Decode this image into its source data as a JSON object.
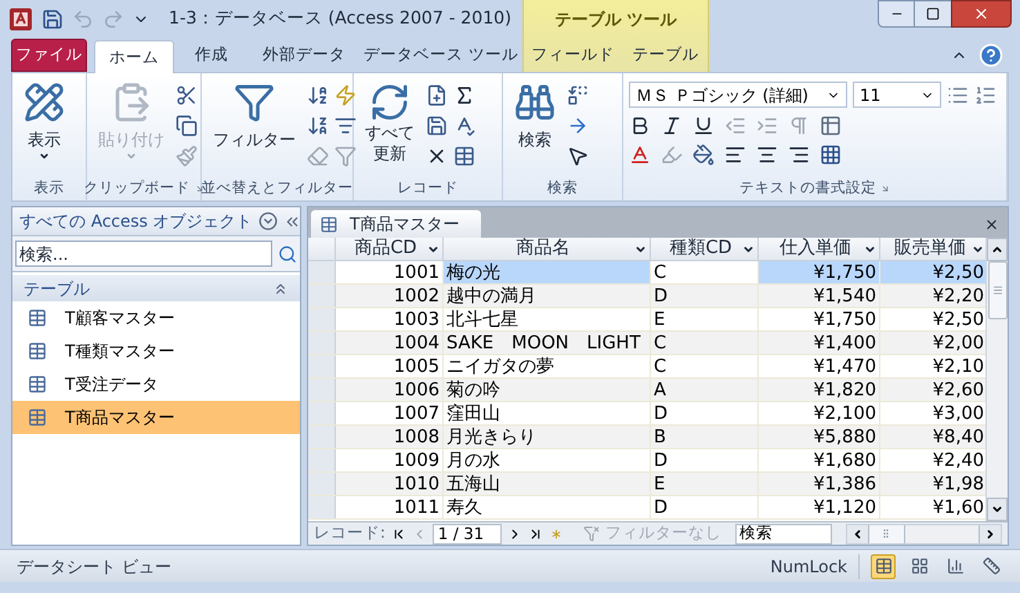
{
  "window": {
    "title": "1-3：データベース (Access 2007 - 2010)",
    "context_tab": "テーブル ツール"
  },
  "ribbon_tabs": [
    {
      "label": "ファイル",
      "kind": "file",
      "selected": false
    },
    {
      "label": "ホーム",
      "kind": "tab",
      "selected": true
    },
    {
      "label": "作成",
      "kind": "tab",
      "selected": false
    },
    {
      "label": "外部データ",
      "kind": "tab",
      "selected": false
    },
    {
      "label": "データベース ツール",
      "kind": "tab",
      "selected": false
    },
    {
      "label": "フィールド",
      "kind": "context",
      "selected": false
    },
    {
      "label": "テーブル",
      "kind": "context",
      "selected": false
    }
  ],
  "ribbon": {
    "view_button": "表示",
    "paste_button": {
      "label": "貼り付け",
      "disabled": true
    },
    "filter_button": "フィルター",
    "refresh_button": [
      "すべて",
      "更新"
    ],
    "find_button": "検索",
    "font_name": "ＭＳ Ｐゴシック (詳細)",
    "font_size": "11",
    "groups": [
      "表示",
      "クリップボード",
      "並べ替えとフィルター",
      "レコード",
      "検索",
      "テキストの書式設定"
    ]
  },
  "navigation_pane": {
    "title": "すべての Access オブジェクト",
    "search": {
      "placeholder": "検索..."
    },
    "group": "テーブル",
    "items": [
      {
        "label": "T顧客マスター",
        "selected": false
      },
      {
        "label": "T種類マスター",
        "selected": false
      },
      {
        "label": "T受注データ",
        "selected": false
      },
      {
        "label": "T商品マスター",
        "selected": true
      }
    ]
  },
  "document_tab": "T商品マスター",
  "table": {
    "columns": [
      {
        "label": "商品CD"
      },
      {
        "label": "商品名"
      },
      {
        "label": "種類CD"
      },
      {
        "label": "仕入単価"
      },
      {
        "label": "販売単価"
      }
    ],
    "rows": [
      {
        "selected": true,
        "cells": [
          "1001",
          "梅の光",
          "C",
          "¥1,750",
          "¥2,50"
        ]
      },
      {
        "selected": false,
        "cells": [
          "1002",
          "越中の満月",
          "D",
          "¥1,540",
          "¥2,20"
        ]
      },
      {
        "selected": false,
        "cells": [
          "1003",
          "北斗七星",
          "E",
          "¥1,750",
          "¥2,50"
        ]
      },
      {
        "selected": false,
        "cells": [
          "1004",
          "SAKE　MOON　LIGHT",
          "C",
          "¥1,400",
          "¥2,00"
        ]
      },
      {
        "selected": false,
        "cells": [
          "1005",
          "ニイガタの夢",
          "C",
          "¥1,470",
          "¥2,10"
        ]
      },
      {
        "selected": false,
        "cells": [
          "1006",
          "菊の吟",
          "A",
          "¥1,820",
          "¥2,60"
        ]
      },
      {
        "selected": false,
        "cells": [
          "1007",
          "窪田山",
          "D",
          "¥2,100",
          "¥3,00"
        ]
      },
      {
        "selected": false,
        "cells": [
          "1008",
          "月光きらり",
          "B",
          "¥5,880",
          "¥8,40"
        ]
      },
      {
        "selected": false,
        "cells": [
          "1009",
          "月の水",
          "D",
          "¥1,680",
          "¥2,40"
        ]
      },
      {
        "selected": false,
        "cells": [
          "1010",
          "五海山",
          "E",
          "¥1,386",
          "¥1,98"
        ]
      },
      {
        "selected": false,
        "cells": [
          "1011",
          "寿久",
          "D",
          "¥1,120",
          "¥1,60"
        ]
      }
    ]
  },
  "record_navigator": {
    "label": "レコード:",
    "position": "1 / 31",
    "filter": {
      "label": "フィルターなし",
      "disabled": true
    },
    "search": {
      "value": "検索"
    }
  },
  "status_bar": {
    "text": "データシート ビュー",
    "numlock": "NumLock",
    "views": [
      {
        "kind": "datasheet",
        "selected": true
      },
      {
        "kind": "pivot_table",
        "selected": false
      },
      {
        "kind": "pivot_chart",
        "selected": false
      },
      {
        "kind": "design",
        "selected": false
      }
    ]
  }
}
